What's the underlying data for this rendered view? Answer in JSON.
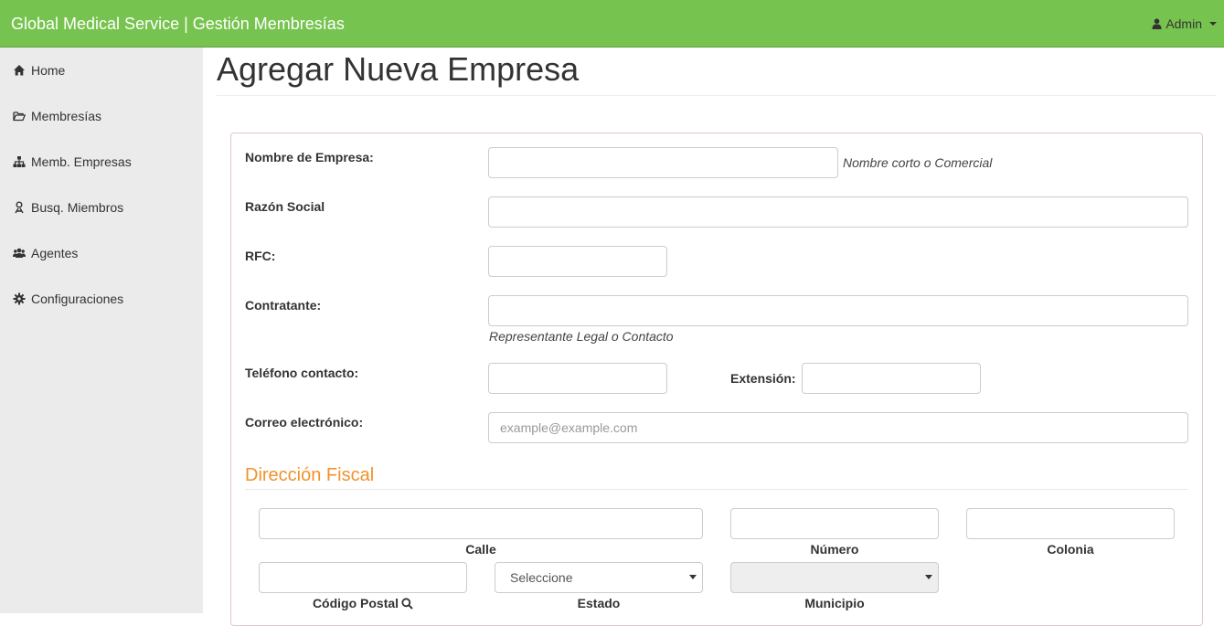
{
  "navbar": {
    "brand": "Global Medical Service | Gestión Membresías",
    "user_label": "Admin"
  },
  "sidebar": {
    "items": [
      {
        "label": "Home",
        "icon": "home-icon"
      },
      {
        "label": "Membresías",
        "icon": "folder-open-icon"
      },
      {
        "label": "Memb. Empresas",
        "icon": "sitemap-icon"
      },
      {
        "label": "Busq. Miembros",
        "icon": "person-icon"
      },
      {
        "label": "Agentes",
        "icon": "users-icon"
      },
      {
        "label": "Configuraciones",
        "icon": "gear-icon"
      }
    ]
  },
  "page": {
    "title": "Agregar Nueva Empresa"
  },
  "form": {
    "nombre_label": "Nombre de Empresa:",
    "nombre_help": "Nombre corto o Comercial",
    "nombre_value": "",
    "razon_label": "Razón Social",
    "razon_value": "",
    "rfc_label": "RFC:",
    "rfc_value": "",
    "contratante_label": "Contratante:",
    "contratante_help": "Representante Legal o Contacto",
    "contratante_value": "",
    "telefono_label": "Teléfono contacto:",
    "telefono_value": "",
    "extension_label": "Extensión:",
    "extension_value": "",
    "correo_label": "Correo electrónico:",
    "correo_placeholder": "example@example.com",
    "correo_value": ""
  },
  "direccion": {
    "title": "Dirección Fiscal",
    "calle_label": "Calle",
    "numero_label": "Número",
    "colonia_label": "Colonia",
    "cp_label": "Código Postal",
    "estado_label": "Estado",
    "estado_selected": "Seleccione",
    "municipio_label": "Municipio",
    "municipio_selected": ""
  },
  "colors": {
    "navbar_bg": "#77c34f",
    "sidebar_bg": "#ebebeb",
    "section_title": "#f0922b"
  }
}
